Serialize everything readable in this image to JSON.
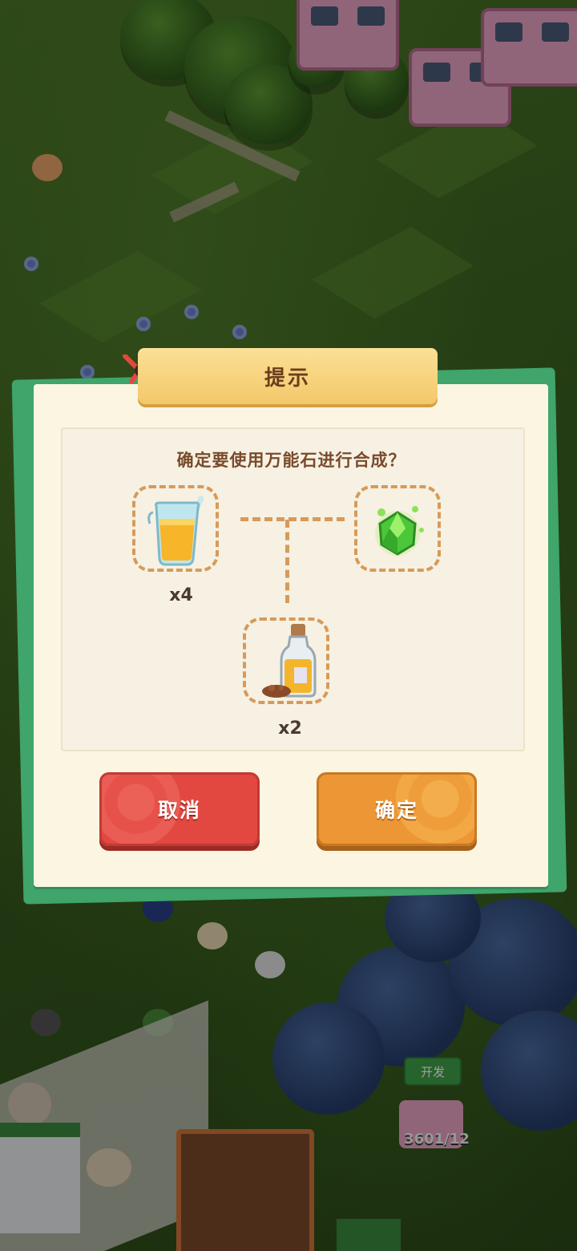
{
  "dialog": {
    "title": "提示",
    "question": "确定要使用万能石进行合成？",
    "ingredients": [
      {
        "icon": "juice-cup-icon",
        "count_label": "x4"
      },
      {
        "icon": "spice-bottle-icon",
        "count_label": "x2"
      }
    ],
    "result_icon": "green-crystal-icon",
    "cancel_label": "取消",
    "confirm_label": "确定"
  },
  "background": {
    "dev_tag": "开发",
    "counter": "3601/12"
  },
  "colors": {
    "dialog_bg": "#fbf5e2",
    "title_tab": "#f3c869",
    "cancel_button": "#e2483f",
    "confirm_button": "#ec9635",
    "dashed_border": "#d89a58"
  }
}
